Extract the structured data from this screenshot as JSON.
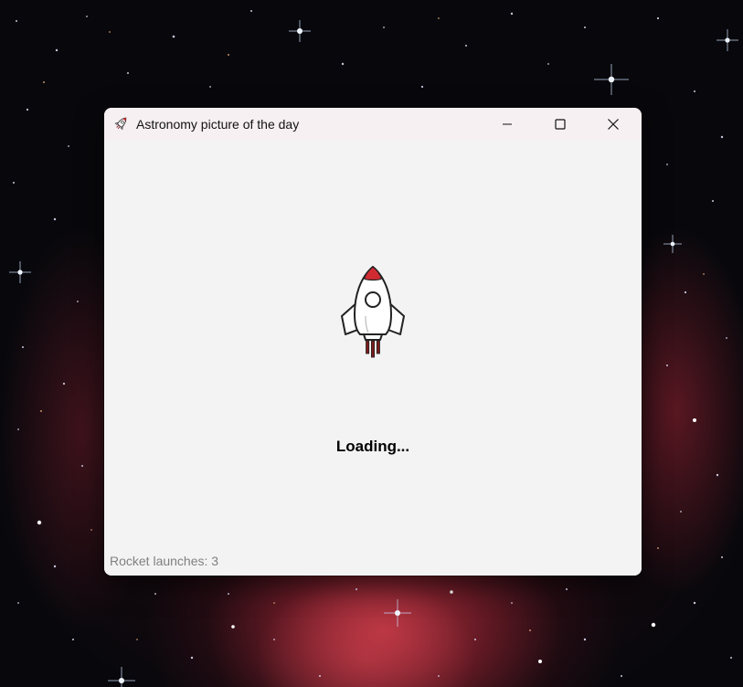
{
  "window": {
    "title": "Astronomy picture of the day",
    "app_icon": "rocket-icon",
    "controls": {
      "minimize": "minimize-icon",
      "maximize": "maximize-icon",
      "close": "close-icon"
    }
  },
  "content": {
    "illustration": "rocket-icon",
    "loading_text": "Loading...",
    "status_text": "Rocket launches: 3"
  },
  "colors": {
    "window_bg": "#f3f3f3",
    "titlebar_bg": "#f7f0f2",
    "status_text": "#808080",
    "rocket_nose": "#d12b32",
    "rocket_exhaust": "#7a1a1c"
  }
}
